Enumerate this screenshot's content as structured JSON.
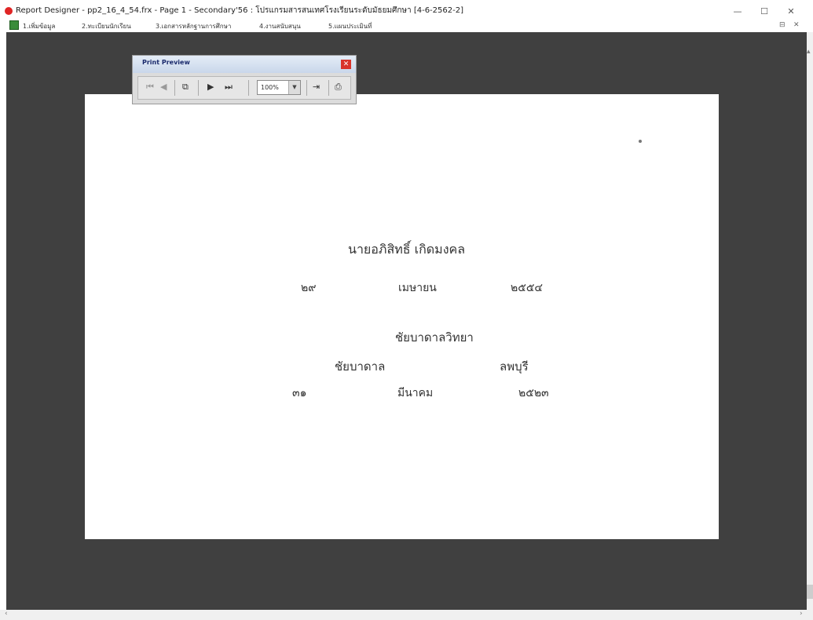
{
  "window": {
    "title": "Report Designer - pp2_16_4_54.frx - Page 1 - Secondary'56 : โปรแกรมสารสนเทศโรงเรียนระดับมัธยมศึกษา [4-6-2562-2]",
    "minimize": "—",
    "maximize": "☐",
    "close": "✕"
  },
  "menu": {
    "items": [
      "1.เพิ่มข้อมูล",
      "2.ทะเบียนนักเรียน",
      "3.เอกสารหลักฐานการศึกษา",
      "4.งานสนับสนุน",
      "5.แผนประเมินที่"
    ],
    "restore": "⊟",
    "close": "✕"
  },
  "print_preview": {
    "title": "Print Preview",
    "zoom": "100%",
    "icons": [
      "first-page-icon",
      "prev-page-icon",
      "copy-icon",
      "next-page-icon",
      "last-page-icon",
      "exit-icon",
      "print-icon"
    ]
  },
  "report": {
    "name": "นายอภิสิทธิ์   เกิดมงคล",
    "issue_day": "๒๙",
    "issue_month": "เมษายน",
    "issue_year": "๒๕๕๔",
    "school": "ชัยบาดาลวิทยา",
    "district": "ชัยบาดาล",
    "province": "ลพบุรี",
    "birth_day": "๓๑",
    "birth_month": "มีนาคม",
    "birth_year": "๒๕๒๓"
  }
}
